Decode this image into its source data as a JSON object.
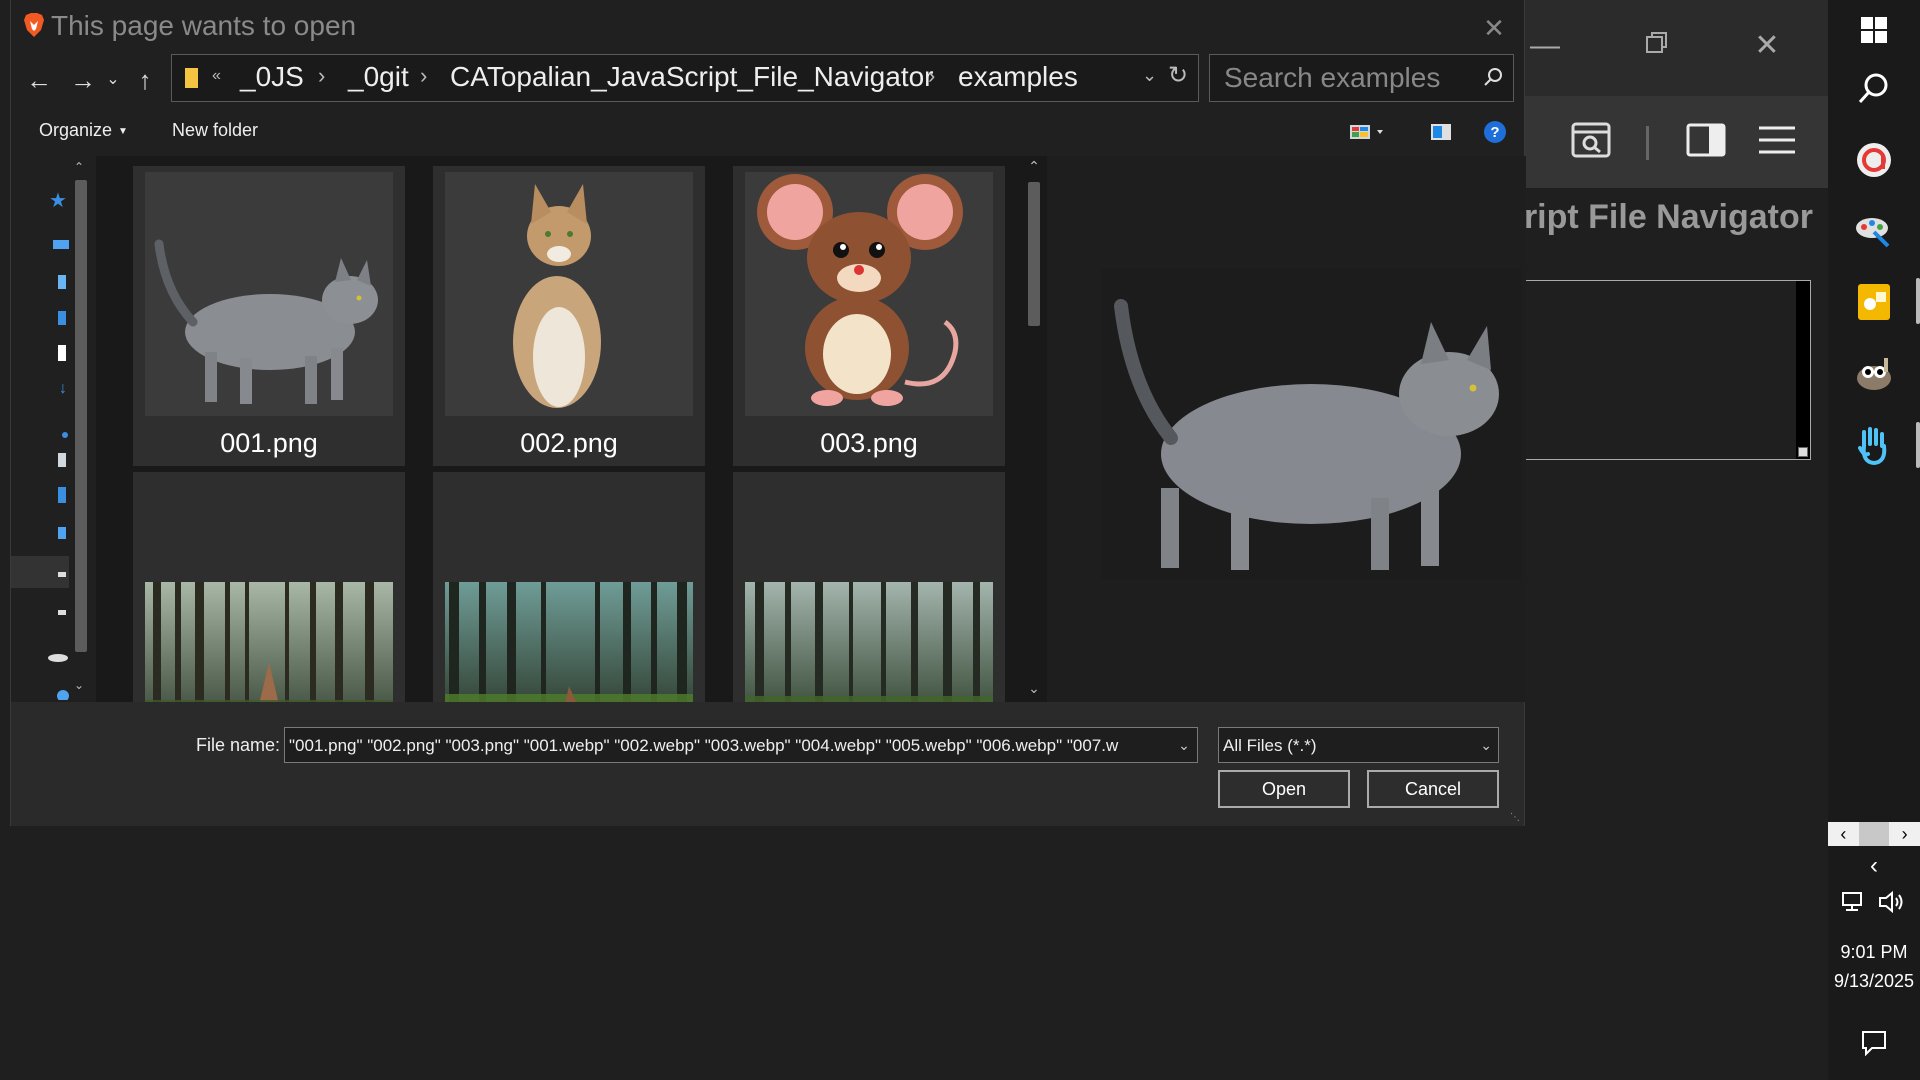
{
  "dialog": {
    "title": "This page wants to open",
    "breadcrumb": [
      "_0JS",
      "_0git",
      "CATopalian_JavaScript_File_Navigator",
      "examples"
    ],
    "search_placeholder": "Search examples",
    "organize_label": "Organize",
    "new_folder_label": "New folder",
    "files": [
      {
        "name": "001.png",
        "kind": "gray-cat"
      },
      {
        "name": "002.png",
        "kind": "tabby-cat"
      },
      {
        "name": "003.png",
        "kind": "mouse"
      },
      {
        "name": "",
        "kind": "forest"
      },
      {
        "name": "",
        "kind": "forest"
      },
      {
        "name": "",
        "kind": "forest"
      }
    ],
    "file_name_label": "File name:",
    "file_name_value": "\"001.png\" \"002.png\" \"003.png\" \"001.webp\" \"002.webp\" \"003.webp\" \"004.webp\" \"005.webp\" \"006.webp\" \"007.w",
    "file_type_value": "All Files (*.*)",
    "open_label": "Open",
    "cancel_label": "Cancel"
  },
  "background_page": {
    "title_fragment": "ript File Navigator"
  },
  "taskbar": {
    "time": "9:01 PM",
    "date": "9/13/2025"
  },
  "colors": {
    "dialog_bg": "#202020",
    "help_blue": "#1e6fd9",
    "brave_orange": "#f25a24"
  }
}
